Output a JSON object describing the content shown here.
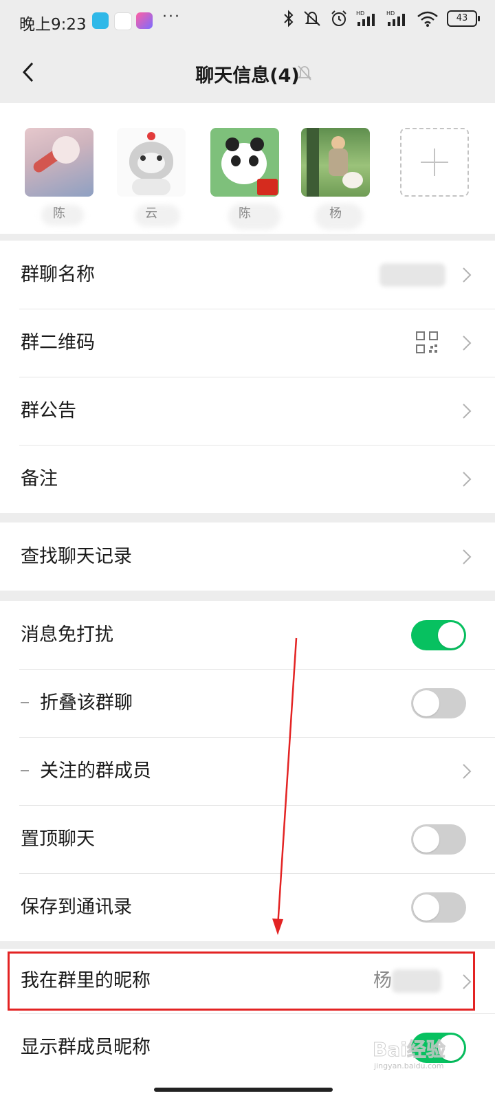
{
  "status_bar": {
    "time": "晚上9:23",
    "more": "···",
    "battery": "43"
  },
  "nav": {
    "title": "聊天信息(4)"
  },
  "members": [
    {
      "name": "陈"
    },
    {
      "name": "云"
    },
    {
      "name": "陈"
    },
    {
      "name": "杨"
    }
  ],
  "info_section": {
    "group_name_label": "群聊名称",
    "qr_label": "群二维码",
    "notice_label": "群公告",
    "remark_label": "备注"
  },
  "search_section": {
    "search_label": "查找聊天记录"
  },
  "settings_section": {
    "mute_label": "消息免打扰",
    "mute_on": true,
    "fold_label": "折叠该群聊",
    "fold_on": false,
    "follow_label": "关注的群成员",
    "pin_label": "置顶聊天",
    "pin_on": false,
    "save_label": "保存到通讯录",
    "save_on": false
  },
  "nickname_section": {
    "nickname_label": "我在群里的昵称",
    "nickname_value": "杨",
    "show_nick_label": "显示群成员昵称",
    "show_nick_on": true
  },
  "watermark": {
    "text": "Bai经验",
    "url": "jingyan.baidu.com"
  },
  "colors": {
    "accent": "#07c160",
    "annotation": "#e32323",
    "background": "#ededed"
  }
}
